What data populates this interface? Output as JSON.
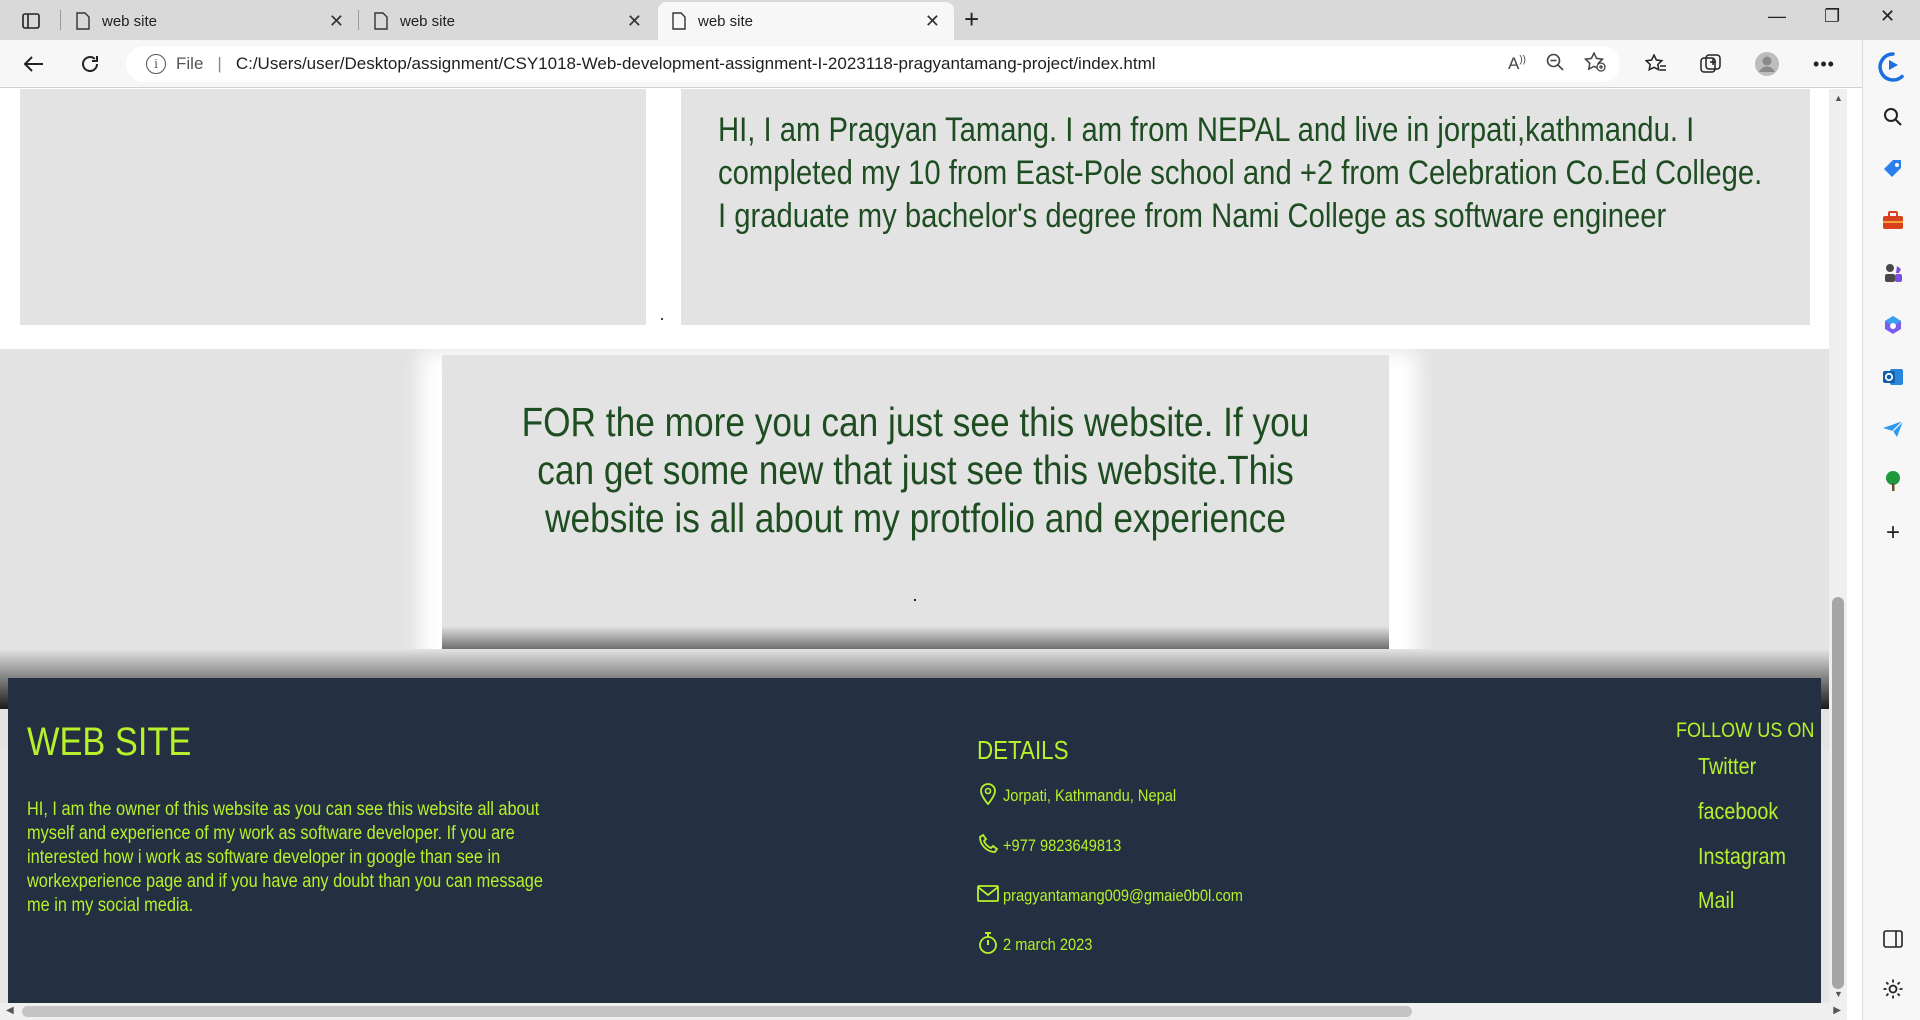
{
  "browser": {
    "tabs": [
      {
        "title": "web site"
      },
      {
        "title": "web site"
      },
      {
        "title": "web site"
      }
    ],
    "address": {
      "file_label": "File",
      "url": "C:/Users/user/Desktop/assignment/CSY1018-Web-development-assignment-I-2023118-pragyantamang-project/index.html"
    }
  },
  "page": {
    "about_text": "HI, I am Pragyan Tamang. I am from NEPAL and live in jorpati,kathmandu. I completed my 10 from East-Pole school and +2 from Celebration Co.Ed College. I graduate my bachelor's degree from Nami College as software engineer",
    "more_text": "FOR the more you can just see this website. If you can get some new that just see this website.This website is all about my protfolio and experience"
  },
  "footer": {
    "title": "WEB SITE",
    "description": "HI, I am the owner of this website as you can see this website all about myself and experience of my work as software developer. If you are interested how i work as software developer in google than see in workexperience page and if you have any doubt than you can message me in my social media.",
    "details_title": "DETAILS",
    "location": "Jorpati, Kathmandu, Nepal",
    "phone": "+977 9823649813",
    "email": "pragyantamang009@gmaie0b0l.com",
    "date": "2 march 2023",
    "follow_title": "FOLLOW US ON",
    "social": [
      "Twitter",
      "facebook",
      "Instagram",
      "Mail"
    ]
  },
  "colors": {
    "accent_green": "#b6f12b",
    "text_dark_green": "#1f4d22",
    "footer_bg": "#243042"
  }
}
